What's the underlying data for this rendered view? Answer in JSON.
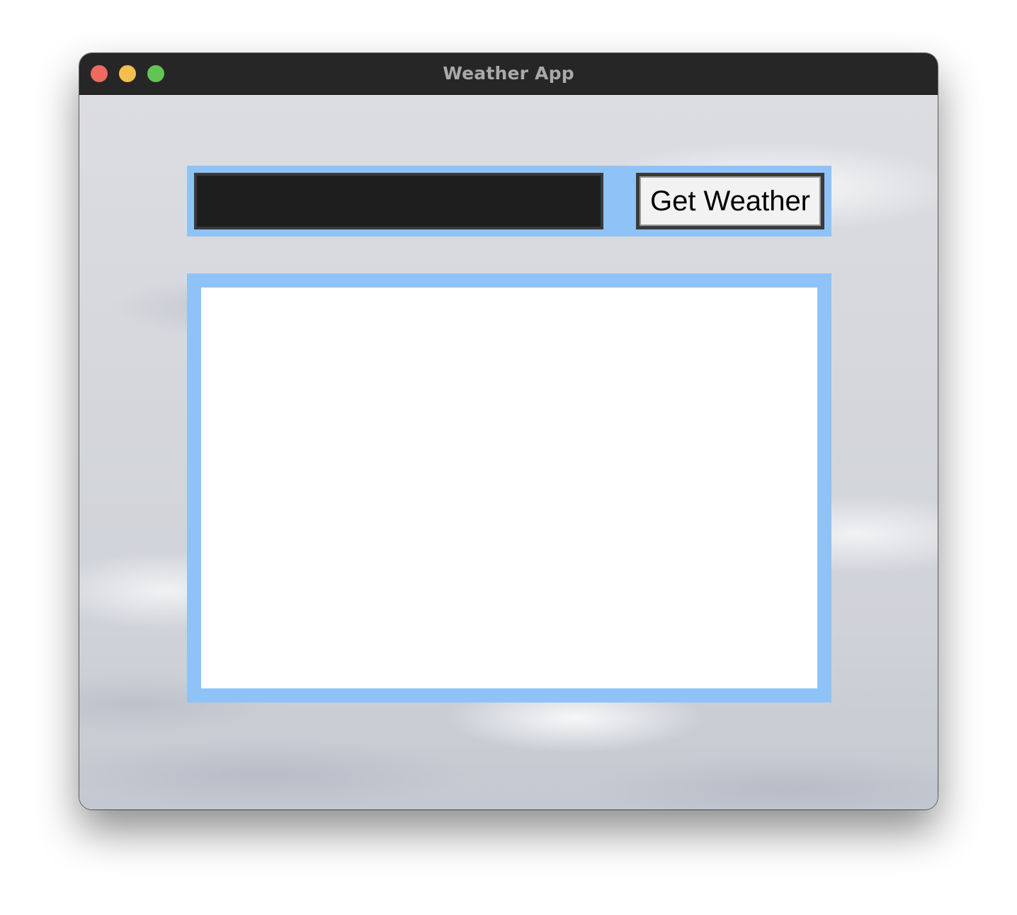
{
  "window": {
    "title": "Weather App"
  },
  "search": {
    "value": "",
    "placeholder": ""
  },
  "actions": {
    "get_weather_label": "Get Weather"
  },
  "result": {
    "text": ""
  },
  "colors": {
    "frame_accent": "#8fc3f7",
    "input_background": "#1e1e1e",
    "titlebar": "#262626"
  }
}
